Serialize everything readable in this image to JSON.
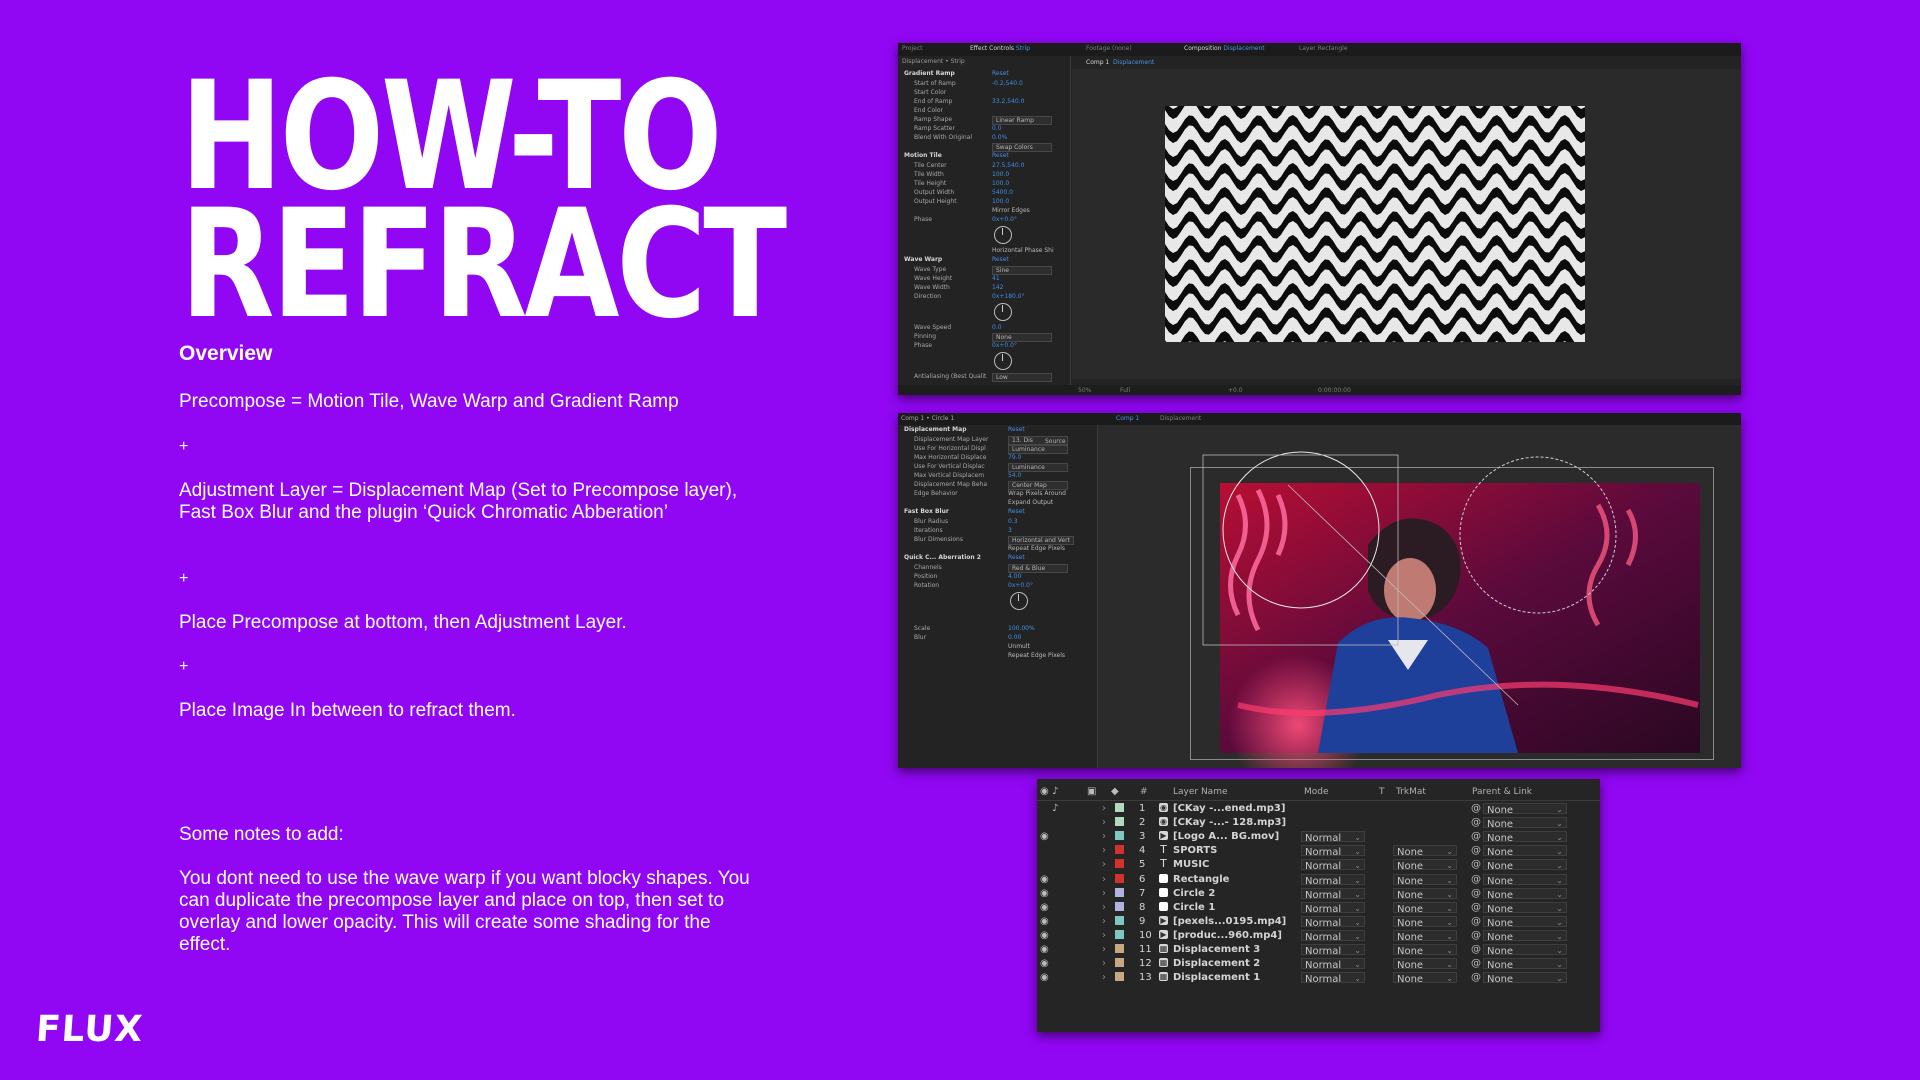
{
  "slide": {
    "title_line1": "HOW-TO",
    "title_line2": "REFRACT",
    "overview_heading": "Overview",
    "step1": "Precompose = Motion Tile,  Wave Warp and Gradient Ramp",
    "plus": "+",
    "step2": "Adjustment Layer = Displacement Map (Set to Precompose layer), Fast Box Blur and the plugin ‘Quick Chromatic Abberation’",
    "step3": "Place Precompose at bottom, then Adjustment Layer.",
    "step4": "Place Image In between to refract them.",
    "notes_heading": "Some notes to add:",
    "notes_body": "You dont need to use the wave warp if you want blocky shapes. You can duplicate the precompose layer and place on top, then set to overlay and lower opacity. This will create some shading for the effect.",
    "logo": "FLUX",
    "background_color": "#9107f4"
  },
  "panel1": {
    "tab_project": "Project",
    "tab_effect_controls": "Effect Controls",
    "tab_effect_layer": "Strip",
    "tab_footage": "Footage  (none)",
    "tab_composition": "Composition",
    "tab_comp_name": "Displacement",
    "tab_layer": "Layer  Rectangle",
    "breadcrumb": "Displacement • Strip",
    "comp_tab1": "Comp 1",
    "comp_tab2": "Displacement",
    "zoom": "50%",
    "resolution": "Full",
    "exposure": "+0.0",
    "timecode": "0:00:00:00",
    "effects": [
      {
        "kind": "head",
        "name": "Gradient Ramp",
        "value": "Reset"
      },
      {
        "kind": "prop",
        "name": "Start of Ramp",
        "value": "-0.2,540.0"
      },
      {
        "kind": "prop",
        "name": "Start Color",
        "value": ""
      },
      {
        "kind": "prop",
        "name": "End of Ramp",
        "value": "33.2,540.0"
      },
      {
        "kind": "prop",
        "name": "End Color",
        "value": ""
      },
      {
        "kind": "prop",
        "name": "Ramp Shape",
        "value": "Linear Ramp",
        "dd": true
      },
      {
        "kind": "prop",
        "name": "Ramp Scatter",
        "value": "0.0"
      },
      {
        "kind": "prop",
        "name": "Blend With Original",
        "value": "0.0%"
      },
      {
        "kind": "prop",
        "name": "",
        "value": "Swap Colors",
        "dd": true
      },
      {
        "kind": "head",
        "name": "Motion Tile",
        "value": "Reset"
      },
      {
        "kind": "prop",
        "name": "Tile Center",
        "value": "27.5,540.0"
      },
      {
        "kind": "prop",
        "name": "Tile Width",
        "value": "100.0"
      },
      {
        "kind": "prop",
        "name": "Tile Height",
        "value": "100.0"
      },
      {
        "kind": "prop",
        "name": "Output Width",
        "value": "5400.0"
      },
      {
        "kind": "prop",
        "name": "Output Height",
        "value": "100.0"
      },
      {
        "kind": "prop",
        "name": "",
        "value": "Mirror Edges",
        "w": true
      },
      {
        "kind": "prop",
        "name": "Phase",
        "value": "0x+0.0°"
      },
      {
        "kind": "dial"
      },
      {
        "kind": "prop",
        "name": "",
        "value": "Horizontal Phase Shi",
        "w": true
      },
      {
        "kind": "head",
        "name": "Wave Warp",
        "value": "Reset"
      },
      {
        "kind": "prop",
        "name": "Wave Type",
        "value": "Sine",
        "dd": true
      },
      {
        "kind": "prop",
        "name": "Wave Height",
        "value": "41"
      },
      {
        "kind": "prop",
        "name": "Wave Width",
        "value": "142"
      },
      {
        "kind": "prop",
        "name": "Direction",
        "value": "0x+180.0°"
      },
      {
        "kind": "dial"
      },
      {
        "kind": "prop",
        "name": "Wave Speed",
        "value": "0.0"
      },
      {
        "kind": "prop",
        "name": "Pinning",
        "value": "None",
        "dd": true
      },
      {
        "kind": "prop",
        "name": "Phase",
        "value": "0x+0.0°"
      },
      {
        "kind": "dial"
      },
      {
        "kind": "prop",
        "name": "Antialiasing (Best Qualit",
        "value": "Low",
        "dd": true
      }
    ]
  },
  "panel2": {
    "breadcrumb": "Comp 1 • Circle 1",
    "comp_tab1": "Comp 1",
    "comp_tab2": "Displacement",
    "effects": [
      {
        "kind": "head",
        "name": "Displacement Map",
        "value": "Reset"
      },
      {
        "kind": "prop",
        "name": "Displacement Map Layer",
        "value": "13. Dis",
        "dd": true
      },
      {
        "kind": "prop",
        "name": "Use For Horizontal Displ",
        "value": "Luminance",
        "dd": true
      },
      {
        "kind": "prop",
        "name": "Max Horizontal Displace",
        "value": "79.0"
      },
      {
        "kind": "prop",
        "name": "Use For Vertical Displac",
        "value": "Luminance",
        "dd": true
      },
      {
        "kind": "prop",
        "name": "Max Vertical Displacem",
        "value": "54.0"
      },
      {
        "kind": "prop",
        "name": "Displacement Map Beha",
        "value": "Center Map",
        "dd": true
      },
      {
        "kind": "prop",
        "name": "Edge Behavior",
        "value": "Wrap Pixels Around",
        "w": true
      },
      {
        "kind": "prop",
        "name": "",
        "value": "Expand Output",
        "w": true
      },
      {
        "kind": "head",
        "name": "Fast Box Blur",
        "value": "Reset"
      },
      {
        "kind": "prop",
        "name": "Blur Radius",
        "value": "0.3"
      },
      {
        "kind": "prop",
        "name": "Iterations",
        "value": "3"
      },
      {
        "kind": "prop",
        "name": "Blur Dimensions",
        "value": "Horizontal and Vert",
        "dd": true
      },
      {
        "kind": "prop",
        "name": "",
        "value": "Repeat Edge Pixels",
        "w": true
      },
      {
        "kind": "head",
        "name": "Quick C... Aberration 2",
        "value": "Reset"
      },
      {
        "kind": "prop",
        "name": "Channels",
        "value": "Red & Blue",
        "dd": true
      },
      {
        "kind": "prop",
        "name": "Position",
        "value": "4.00"
      },
      {
        "kind": "prop",
        "name": "Rotation",
        "value": "0x+0.0°"
      },
      {
        "kind": "dial"
      },
      {
        "kind": "gap"
      },
      {
        "kind": "prop",
        "name": "Scale",
        "value": "100.00%"
      },
      {
        "kind": "prop",
        "name": "Blur",
        "value": "0.00"
      },
      {
        "kind": "prop",
        "name": "",
        "value": "Unmult",
        "w": true
      },
      {
        "kind": "prop",
        "name": "",
        "value": "Repeat Edge Pixels",
        "w": true
      }
    ],
    "source_label": "Source"
  },
  "timeline": {
    "col_num": "#",
    "col_layer_name": "Layer Name",
    "col_mode": "Mode",
    "col_t": "T",
    "col_trkmat": "TrkMat",
    "col_parent": "Parent & Link",
    "layers": [
      {
        "num": "1",
        "name": "[CKay -...ened.mp3]",
        "icon": "audio",
        "label": "#b2d8c0",
        "mode": "",
        "trk": "",
        "parent": "None",
        "eye": false,
        "speaker": true
      },
      {
        "num": "2",
        "name": "[CKay -...- 128.mp3]",
        "icon": "audio",
        "label": "#b2d8c0",
        "mode": "",
        "trk": "",
        "parent": "None",
        "eye": false,
        "speaker": false
      },
      {
        "num": "3",
        "name": "[Logo A... BG.mov]",
        "icon": "video",
        "label": "#7fc8c0",
        "mode": "Normal",
        "trk": "",
        "parent": "None",
        "eye": true,
        "speaker": false
      },
      {
        "num": "4",
        "name": "SPORTS",
        "icon": "text",
        "label": "#d2322d",
        "mode": "Normal",
        "trk": "None",
        "parent": "None",
        "eye": false,
        "speaker": false
      },
      {
        "num": "5",
        "name": "MUSIC",
        "icon": "text",
        "label": "#d2322d",
        "mode": "Normal",
        "trk": "None",
        "parent": "None",
        "eye": false,
        "speaker": false
      },
      {
        "num": "6",
        "name": "Rectangle",
        "icon": "solid",
        "label": "#d2322d",
        "mode": "Normal",
        "trk": "None",
        "parent": "None",
        "eye": true,
        "speaker": false
      },
      {
        "num": "7",
        "name": "Circle 2",
        "icon": "solid",
        "label": "#b3b3e0",
        "mode": "Normal",
        "trk": "None",
        "parent": "None",
        "eye": true,
        "speaker": false
      },
      {
        "num": "8",
        "name": "Circle 1",
        "icon": "solid",
        "label": "#b3b3e0",
        "mode": "Normal",
        "trk": "None",
        "parent": "None",
        "eye": true,
        "speaker": false
      },
      {
        "num": "9",
        "name": "[pexels...0195.mp4]",
        "icon": "video",
        "label": "#7fc8c0",
        "mode": "Normal",
        "trk": "None",
        "parent": "None",
        "eye": true,
        "speaker": false
      },
      {
        "num": "10",
        "name": "[produc...960.mp4]",
        "icon": "video",
        "label": "#7fc8c0",
        "mode": "Normal",
        "trk": "None",
        "parent": "None",
        "eye": true,
        "speaker": false
      },
      {
        "num": "11",
        "name": "Displacement 3",
        "icon": "comp",
        "label": "#c8a882",
        "mode": "Normal",
        "trk": "None",
        "parent": "None",
        "eye": true,
        "speaker": false
      },
      {
        "num": "12",
        "name": "Displacement 2",
        "icon": "comp",
        "label": "#c8a882",
        "mode": "Normal",
        "trk": "None",
        "parent": "None",
        "eye": true,
        "speaker": false
      },
      {
        "num": "13",
        "name": "Displacement 1",
        "icon": "comp",
        "label": "#c8a882",
        "mode": "Normal",
        "trk": "None",
        "parent": "None",
        "eye": true,
        "speaker": false
      }
    ]
  }
}
